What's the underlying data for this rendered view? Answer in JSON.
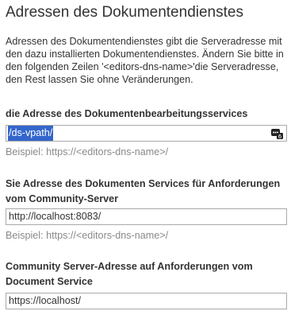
{
  "page": {
    "title": "Adressen des Dokumentendienstes",
    "description": "Adressen des Dokumentendienstes gibt die Serveradresse mit den dazu installierten Dokumentendienstes. Ändern Sie bitte in den folgenden Zeilen '<editors-dns-name>'die Serveradresse, den Rest lassen Sie ohne Veränderungen."
  },
  "fields": [
    {
      "label": "die Adresse des Dokumentenbearbeitungsservices",
      "value": "/ds-vpath/",
      "example": "Beispiel: https://<editors-dns-name>/",
      "selected": true
    },
    {
      "label": "Sie Adresse des Dokumenten Services für Anforderungen vom Community-Server",
      "value": "http://localhost:8083/",
      "example": "Beispiel: https://<editors-dns-name>/"
    },
    {
      "label": "Community Server-Adresse auf Anforderungen vom Document Service",
      "value": "https://localhost/"
    }
  ],
  "icons": {
    "field_addon": "password-manager-icon",
    "badge": "6"
  },
  "colors": {
    "selection": "#3366cc",
    "example_text": "#8a8a8a",
    "input_border": "#a9a9a9"
  }
}
